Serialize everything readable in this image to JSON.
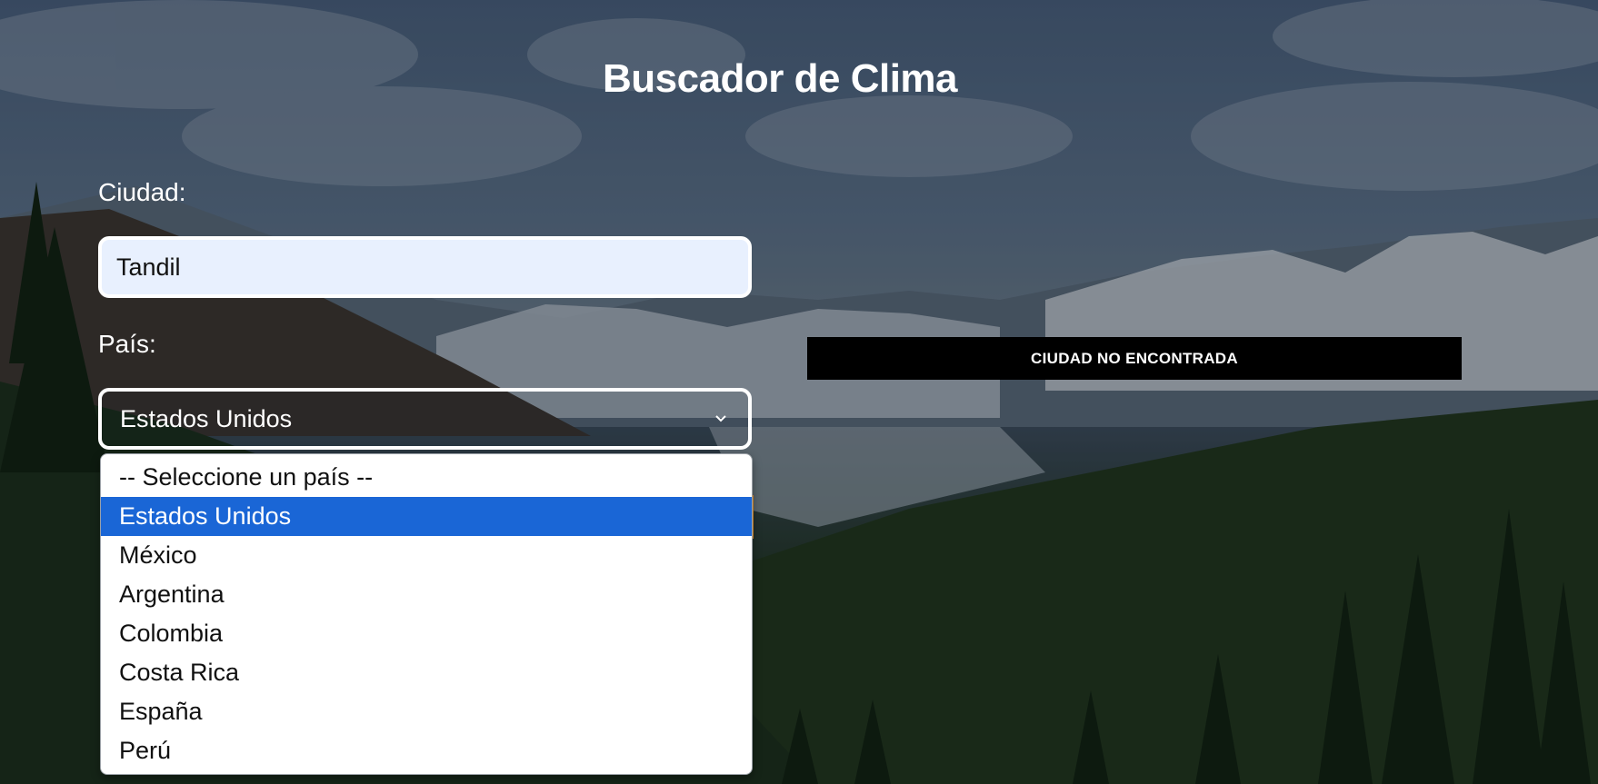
{
  "page": {
    "title": "Buscador de Clima"
  },
  "form": {
    "city_label": "Ciudad:",
    "city_value": "Tandil",
    "country_label": "País:",
    "country_selected": "Estados Unidos",
    "country_options": [
      "-- Seleccione un país --",
      "Estados Unidos",
      "México",
      "Argentina",
      "Colombia",
      "Costa Rica",
      "España",
      "Perú"
    ],
    "selected_index": 1
  },
  "result": {
    "error_text": "CIUDAD NO ENCONTRADA"
  },
  "colors": {
    "highlight": "#1a66d6",
    "banner_bg": "#000000",
    "input_bg": "#e8f0fe"
  },
  "icons": {
    "select_arrow": "chevron-down-icon"
  }
}
